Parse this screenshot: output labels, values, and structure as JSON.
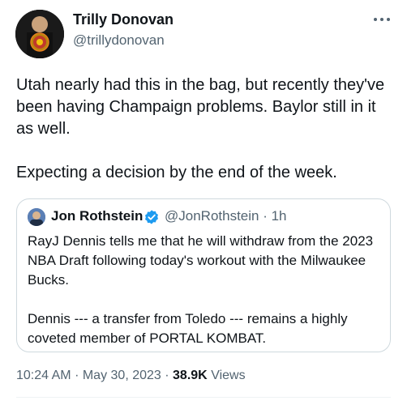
{
  "author": {
    "display_name": "Trilly Donovan",
    "handle": "@trillydonovan",
    "avatar_icon": "profile-photo-icon"
  },
  "more_icon": "more-dots-icon",
  "tweet": {
    "paragraphs": [
      "Utah nearly had this in the bag, but recently they've been having Champaign problems. Baylor still in it as well.",
      "Expecting a decision by the end of the week."
    ]
  },
  "quote": {
    "display_name": "Jon Rothstein",
    "handle_time": "@JonRothstein · 1h",
    "verified_icon": "verified-badge-icon",
    "verified_color": "#1d9bf0",
    "paragraphs": [
      "RayJ Dennis tells me that he will withdraw from the 2023 NBA Draft following today's workout with the Milwaukee Bucks.",
      "Dennis --- a transfer from Toledo --- remains a highly coveted member of PORTAL KOMBAT."
    ]
  },
  "meta": {
    "time": "10:24 AM",
    "separator": "·",
    "date": "May 30, 2023",
    "separator2": "·",
    "views_count": "38.9K",
    "views_label": "Views"
  },
  "colors": {
    "text_primary": "#0f1419",
    "text_secondary": "#536471",
    "border": "#cfd9de"
  }
}
